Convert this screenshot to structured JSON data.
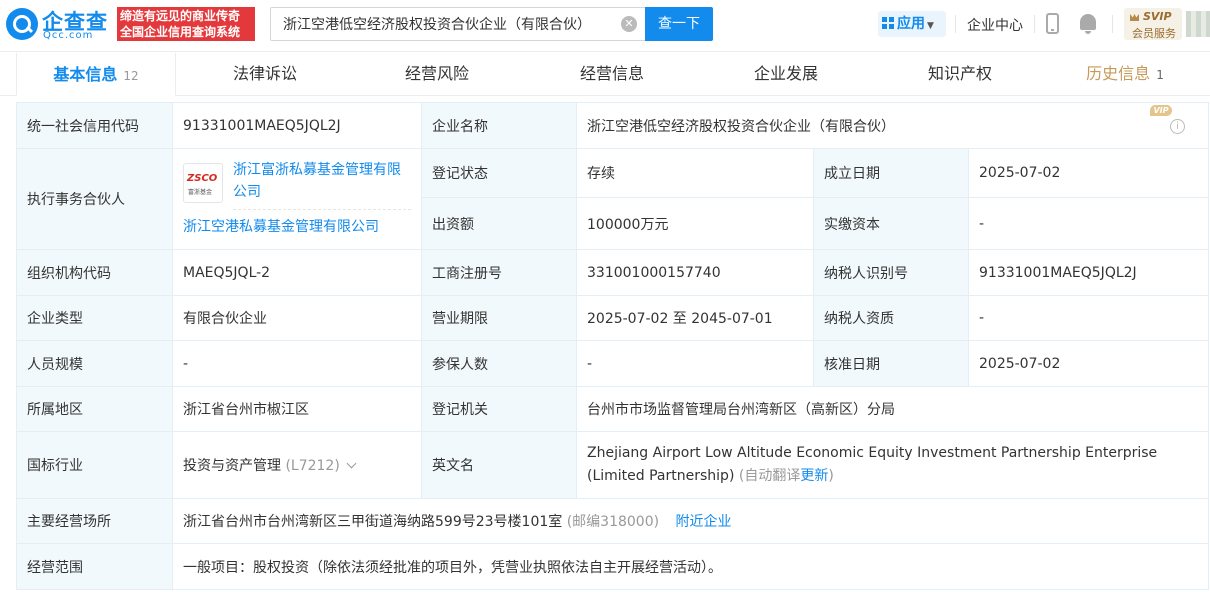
{
  "header": {
    "logo_name": "企查查",
    "logo_domain": "Qcc.com",
    "slogan_line1": "缔造有远见的商业传奇",
    "slogan_line2": "全国企业信用查询系统",
    "search_value": "浙江空港低空经济股权投资合伙企业（有限合伙）",
    "search_button": "查一下",
    "app_label": "应用",
    "enterprise_center": "企业中心",
    "svip_label": "SVIP",
    "svip_sub": "会员服务"
  },
  "tabs": [
    {
      "label": "基本信息",
      "count": "12"
    },
    {
      "label": "法律诉讼"
    },
    {
      "label": "经营风险"
    },
    {
      "label": "经营信息"
    },
    {
      "label": "企业发展"
    },
    {
      "label": "知识产权"
    },
    {
      "label": "历史信息",
      "count": "1",
      "badge": "VIP"
    }
  ],
  "info": {
    "credit_code_label": "统一社会信用代码",
    "credit_code": "91331001MAEQ5JQL2J",
    "company_name_label": "企业名称",
    "company_name": "浙江空港低空经济股权投资合伙企业（有限合伙）",
    "partner_label": "执行事务合伙人",
    "partner_logo_text": "ZSCO",
    "partner_logo_sub": "富浙基金",
    "partner_name": "浙江富浙私募基金管理有限公司",
    "partner_sub": "浙江空港私募基金管理有限公司",
    "status_label": "登记状态",
    "status": "存续",
    "established_label": "成立日期",
    "established": "2025-07-02",
    "capital_label": "出资额",
    "capital": "100000万元",
    "paid_capital_label": "实缴资本",
    "paid_capital": "-",
    "org_code_label": "组织机构代码",
    "org_code": "MAEQ5JQL-2",
    "reg_no_label": "工商注册号",
    "reg_no": "331001000157740",
    "taxpayer_id_label": "纳税人识别号",
    "taxpayer_id": "91331001MAEQ5JQL2J",
    "type_label": "企业类型",
    "type": "有限合伙企业",
    "term_label": "营业期限",
    "term": "2025-07-02 至 2045-07-01",
    "taxpayer_qual_label": "纳税人资质",
    "taxpayer_qual": "-",
    "staff_label": "人员规模",
    "staff": "-",
    "insured_label": "参保人数",
    "insured": "-",
    "approval_label": "核准日期",
    "approval": "2025-07-02",
    "region_label": "所属地区",
    "region": "浙江省台州市椒江区",
    "authority_label": "登记机关",
    "authority": "台州市市场监督管理局台州湾新区（高新区）分局",
    "industry_label": "国标行业",
    "industry": "投资与资产管理",
    "industry_code": "(L7212)",
    "english_label": "英文名",
    "english": "Zhejiang Airport Low Altitude Economic Equity Investment Partnership Enterprise (Limited Partnership)",
    "auto_translate_prefix": "(自动翻译",
    "auto_translate_link": "更新",
    "auto_translate_suffix": ")",
    "address_label": "主要经营场所",
    "address": "浙江省台州市台州湾新区三甲街道海纳路599号23号楼101室",
    "postcode": "(邮编318000)",
    "nearby_link": "附近企业",
    "scope_label": "经营范围",
    "scope": "一般项目：股权投资（除依法须经批准的项目外，凭营业执照依法自主开展经营活动）。"
  }
}
